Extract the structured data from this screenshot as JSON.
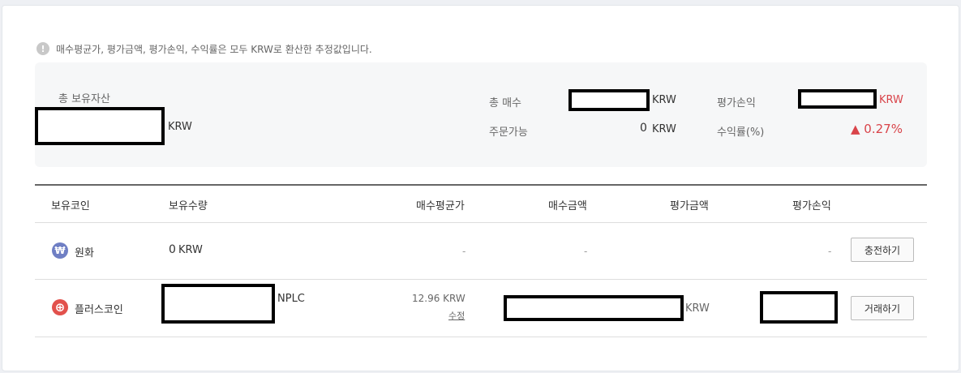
{
  "notice": {
    "icon": "exclamation-icon",
    "text": "매수평균가, 평가금액, 평가손익, 수익률은 모두 KRW로 환산한 추정값입니다."
  },
  "summary": {
    "total_assets_label": "총 보유자산",
    "total_assets_unit": "KRW",
    "total_buy_label": "총 매수",
    "total_buy_unit": "KRW",
    "available_label": "주문가능",
    "available_value": "0",
    "available_unit": "KRW",
    "pnl_label": "평가손익",
    "pnl_unit": "KRW",
    "return_label": "수익률(%)",
    "return_value": "▲ 0.27%"
  },
  "table": {
    "headers": {
      "coin": "보유코인",
      "qty": "보유수량",
      "avg_price": "매수평균가",
      "buy_amount": "매수금액",
      "eval_amount": "평가금액",
      "pnl": "평가손익"
    },
    "rows": [
      {
        "icon": "won-icon",
        "icon_glyph": "₩",
        "icon_color": "#6f7fc4",
        "coin": "원화",
        "qty_value": "0",
        "qty_unit": "KRW",
        "avg_price": "-",
        "buy_amount": "-",
        "pnl": "-",
        "action": "충전하기"
      },
      {
        "icon": "plus-coin-icon",
        "icon_glyph": "⊕",
        "icon_color": "#e2514c",
        "coin": "플러스코인",
        "qty_unit": "NPLC",
        "avg_price": "12.96 KRW",
        "avg_price_edit": "수정",
        "eval_unit": "KRW",
        "action": "거래하기"
      }
    ]
  },
  "colors": {
    "accent_red": "#d9444a",
    "header_border": "#666666"
  }
}
